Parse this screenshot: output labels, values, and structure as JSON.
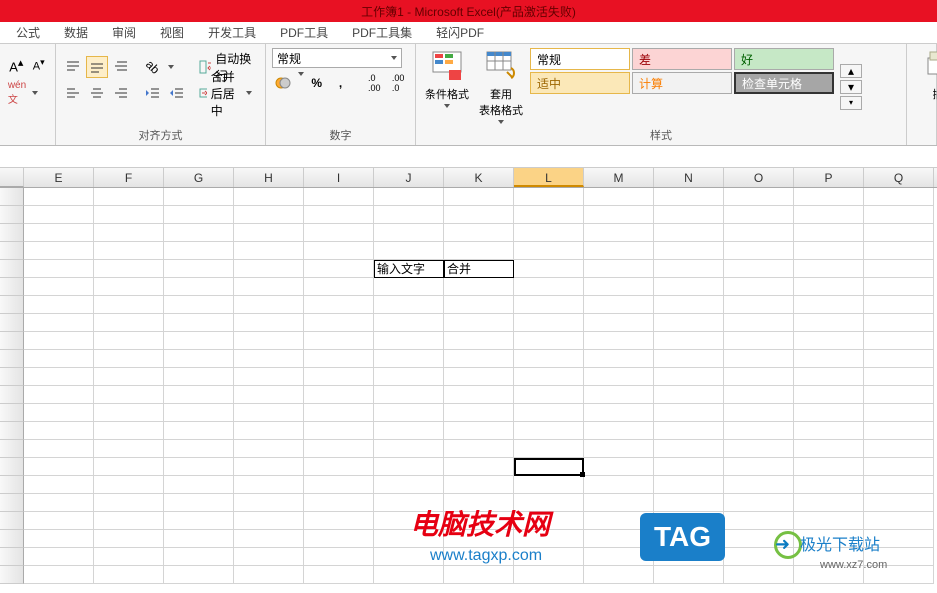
{
  "title": "工作簿1 - Microsoft Excel(产品激活失败)",
  "menu": {
    "tabs": [
      "公式",
      "数据",
      "审阅",
      "视图",
      "开发工具",
      "PDF工具",
      "PDF工具集",
      "轻闪PDF"
    ]
  },
  "ribbon": {
    "align_group_label": "对齐方式",
    "wrap_label": "自动换行",
    "merge_label": "合并后居中",
    "number_group_label": "数字",
    "number_format": "常规",
    "styles_group_label": "样式",
    "cond_format_label": "条件格式",
    "table_format_label": "套用\n表格格式",
    "style_normal": "常规",
    "style_bad": "差",
    "style_good": "好",
    "style_fit": "适中",
    "style_calc": "计算",
    "style_check": "检查单元格",
    "insert_label": "插"
  },
  "columns": [
    "E",
    "F",
    "G",
    "H",
    "I",
    "J",
    "K",
    "L",
    "M",
    "N",
    "O",
    "P",
    "Q"
  ],
  "selected_col": "L",
  "cell_J6": "输入文字",
  "cell_K6": "合并",
  "watermark": {
    "site1_name": "电脑技术网",
    "site1_url": "www.tagxp.com",
    "tag_text": "TAG",
    "site2_name": "极光下载站",
    "site2_url": "www.xz7.com"
  }
}
